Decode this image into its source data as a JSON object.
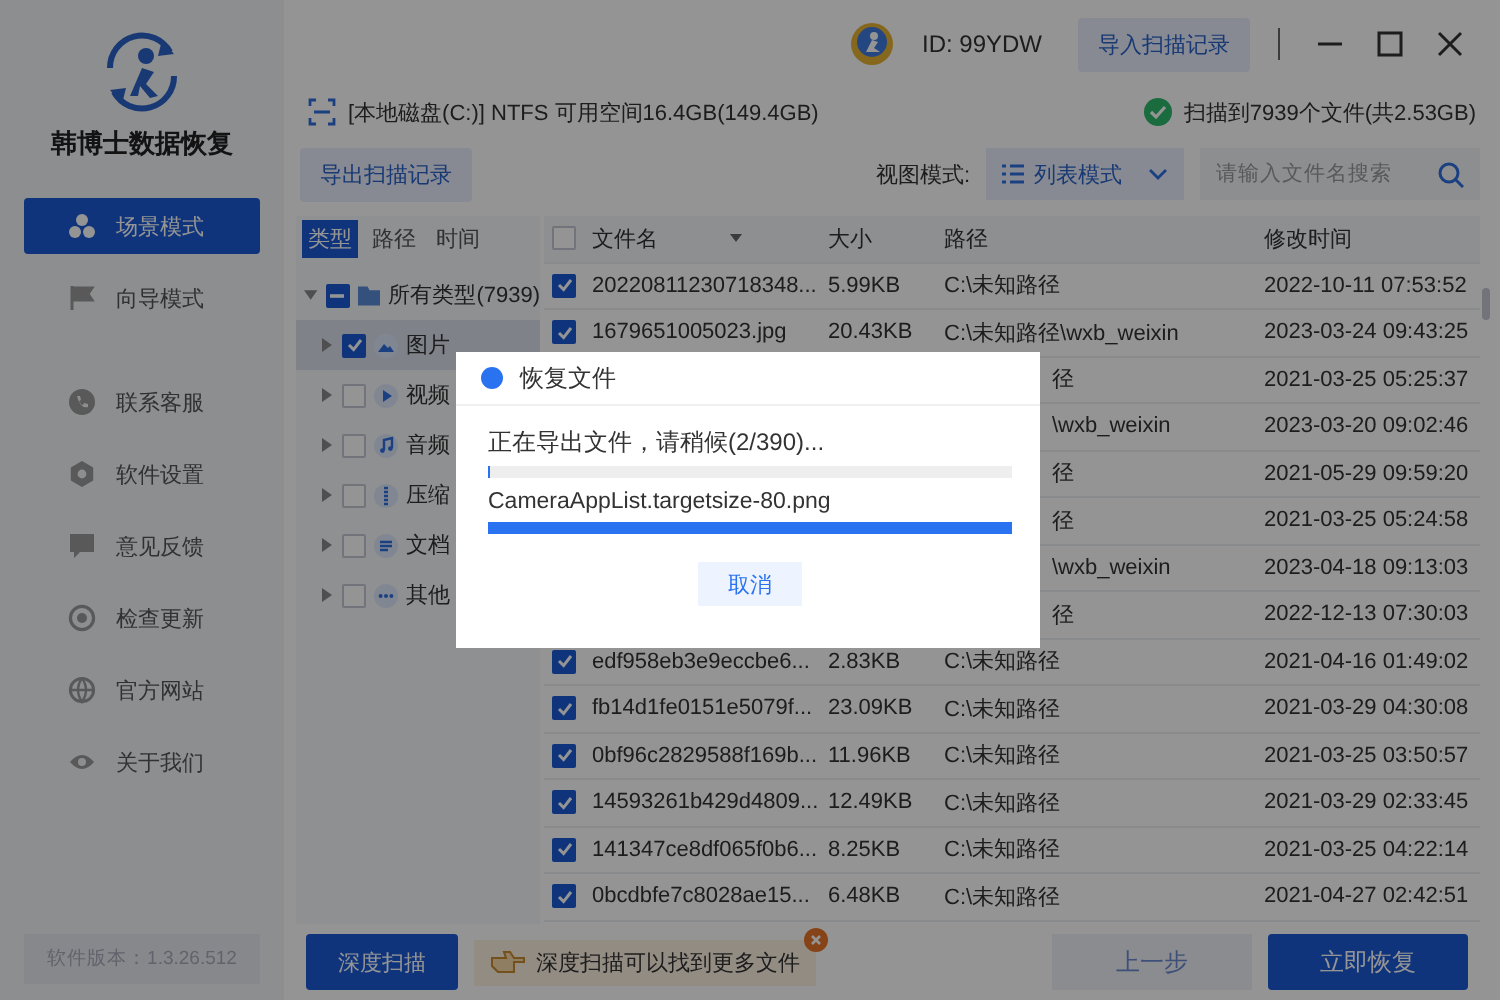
{
  "app": {
    "name": "韩博士数据恢复",
    "version": "软件版本：1.3.26.512"
  },
  "nav": [
    {
      "label": "场景模式",
      "selected": true
    },
    {
      "label": "向导模式",
      "selected": false
    },
    {
      "label": "联系客服",
      "selected": false
    },
    {
      "label": "软件设置",
      "selected": false
    },
    {
      "label": "意见反馈",
      "selected": false
    },
    {
      "label": "检查更新",
      "selected": false
    },
    {
      "label": "官方网站",
      "selected": false
    },
    {
      "label": "关于我们",
      "selected": false
    }
  ],
  "topbar": {
    "user_id": "ID: 99YDW",
    "import_button": "导入扫描记录"
  },
  "disk": {
    "info": "[本地磁盘(C:)] NTFS 可用空间16.4GB(149.4GB)",
    "scan_result": "扫描到7939个文件(共2.53GB)"
  },
  "toolbar": {
    "export_button": "导出扫描记录",
    "view_label": "视图模式:",
    "view_mode": "列表模式",
    "search": {
      "placeholder": "请输入文件名搜索"
    }
  },
  "filter_tabs": [
    {
      "label": "类型",
      "selected": true
    },
    {
      "label": "路径",
      "selected": false
    },
    {
      "label": "时间",
      "selected": false
    }
  ],
  "tree": [
    {
      "label": "所有类型(7939)",
      "indeterminate": true,
      "expanded": true,
      "selected": false,
      "children": [
        {
          "label": "图片",
          "checked": true,
          "expanded": false,
          "selected": true
        },
        {
          "label": "视频",
          "checked": false,
          "expanded": false,
          "selected": false
        },
        {
          "label": "音频",
          "checked": false,
          "expanded": false,
          "selected": false
        },
        {
          "label": "压缩",
          "checked": false,
          "expanded": false,
          "selected": false
        },
        {
          "label": "文档",
          "checked": false,
          "expanded": false,
          "selected": false
        },
        {
          "label": "其他",
          "checked": false,
          "expanded": false,
          "selected": false
        }
      ]
    }
  ],
  "table": {
    "columns": [
      "文件名",
      "大小",
      "路径",
      "修改时间"
    ],
    "header_checked": false,
    "rows": [
      {
        "kind": "full",
        "checked": true,
        "name": "20220811230718348...",
        "size": "5.99KB",
        "path": "C:\\未知路径",
        "modified": "2022-10-11 07:53:52"
      },
      {
        "kind": "full",
        "checked": true,
        "name": "1679651005023.jpg",
        "size": "20.43KB",
        "path": "C:\\未知路径\\wxb_weixin",
        "modified": "2023-03-24 09:43:25"
      },
      {
        "kind": "covered",
        "path": "径",
        "modified": "2021-03-25 05:25:37"
      },
      {
        "kind": "covered",
        "path": "\\wxb_weixin",
        "modified": "2023-03-20 09:02:46"
      },
      {
        "kind": "covered",
        "path": "径",
        "modified": "2021-05-29 09:59:20"
      },
      {
        "kind": "covered",
        "path": "径",
        "modified": "2021-03-25 05:24:58"
      },
      {
        "kind": "covered",
        "path": "\\wxb_weixin",
        "modified": "2023-04-18 09:13:03"
      },
      {
        "kind": "covered",
        "path": "径",
        "modified": "2022-12-13 07:30:03"
      },
      {
        "kind": "full",
        "checked": true,
        "name": "edf958eb3e9eccbe6...",
        "size": "2.83KB",
        "path": "C:\\未知路径",
        "modified": "2021-04-16 01:49:02"
      },
      {
        "kind": "full",
        "checked": true,
        "name": "fb14d1fe0151e5079f...",
        "size": "23.09KB",
        "path": "C:\\未知路径",
        "modified": "2021-03-29 04:30:08"
      },
      {
        "kind": "full",
        "checked": true,
        "name": "0bf96c2829588f169b...",
        "size": "11.96KB",
        "path": "C:\\未知路径",
        "modified": "2021-03-25 03:50:57"
      },
      {
        "kind": "full",
        "checked": true,
        "name": "14593261b429d4809...",
        "size": "12.49KB",
        "path": "C:\\未知路径",
        "modified": "2021-03-29 02:33:45"
      },
      {
        "kind": "full",
        "checked": true,
        "name": "141347ce8df065f0b6...",
        "size": "8.25KB",
        "path": "C:\\未知路径",
        "modified": "2021-03-25 04:22:14"
      },
      {
        "kind": "full",
        "checked": true,
        "name": "0bcdbfe7c8028ae15...",
        "size": "6.48KB",
        "path": "C:\\未知路径",
        "modified": "2021-04-27 02:42:51"
      }
    ]
  },
  "bottom": {
    "deep_scan_button": "深度扫描",
    "tip": "深度扫描可以找到更多文件",
    "back_button": "上一步",
    "recover_button": "立即恢复"
  },
  "dialog": {
    "title": "恢复文件",
    "status": "正在导出文件，请稍候(2/390)...",
    "overall_progress": {
      "level": 0.005
    },
    "current_file": "CameraAppList.targetsize-80.png",
    "file_progress": {
      "level": 1
    },
    "cancel_button": "取消"
  }
}
